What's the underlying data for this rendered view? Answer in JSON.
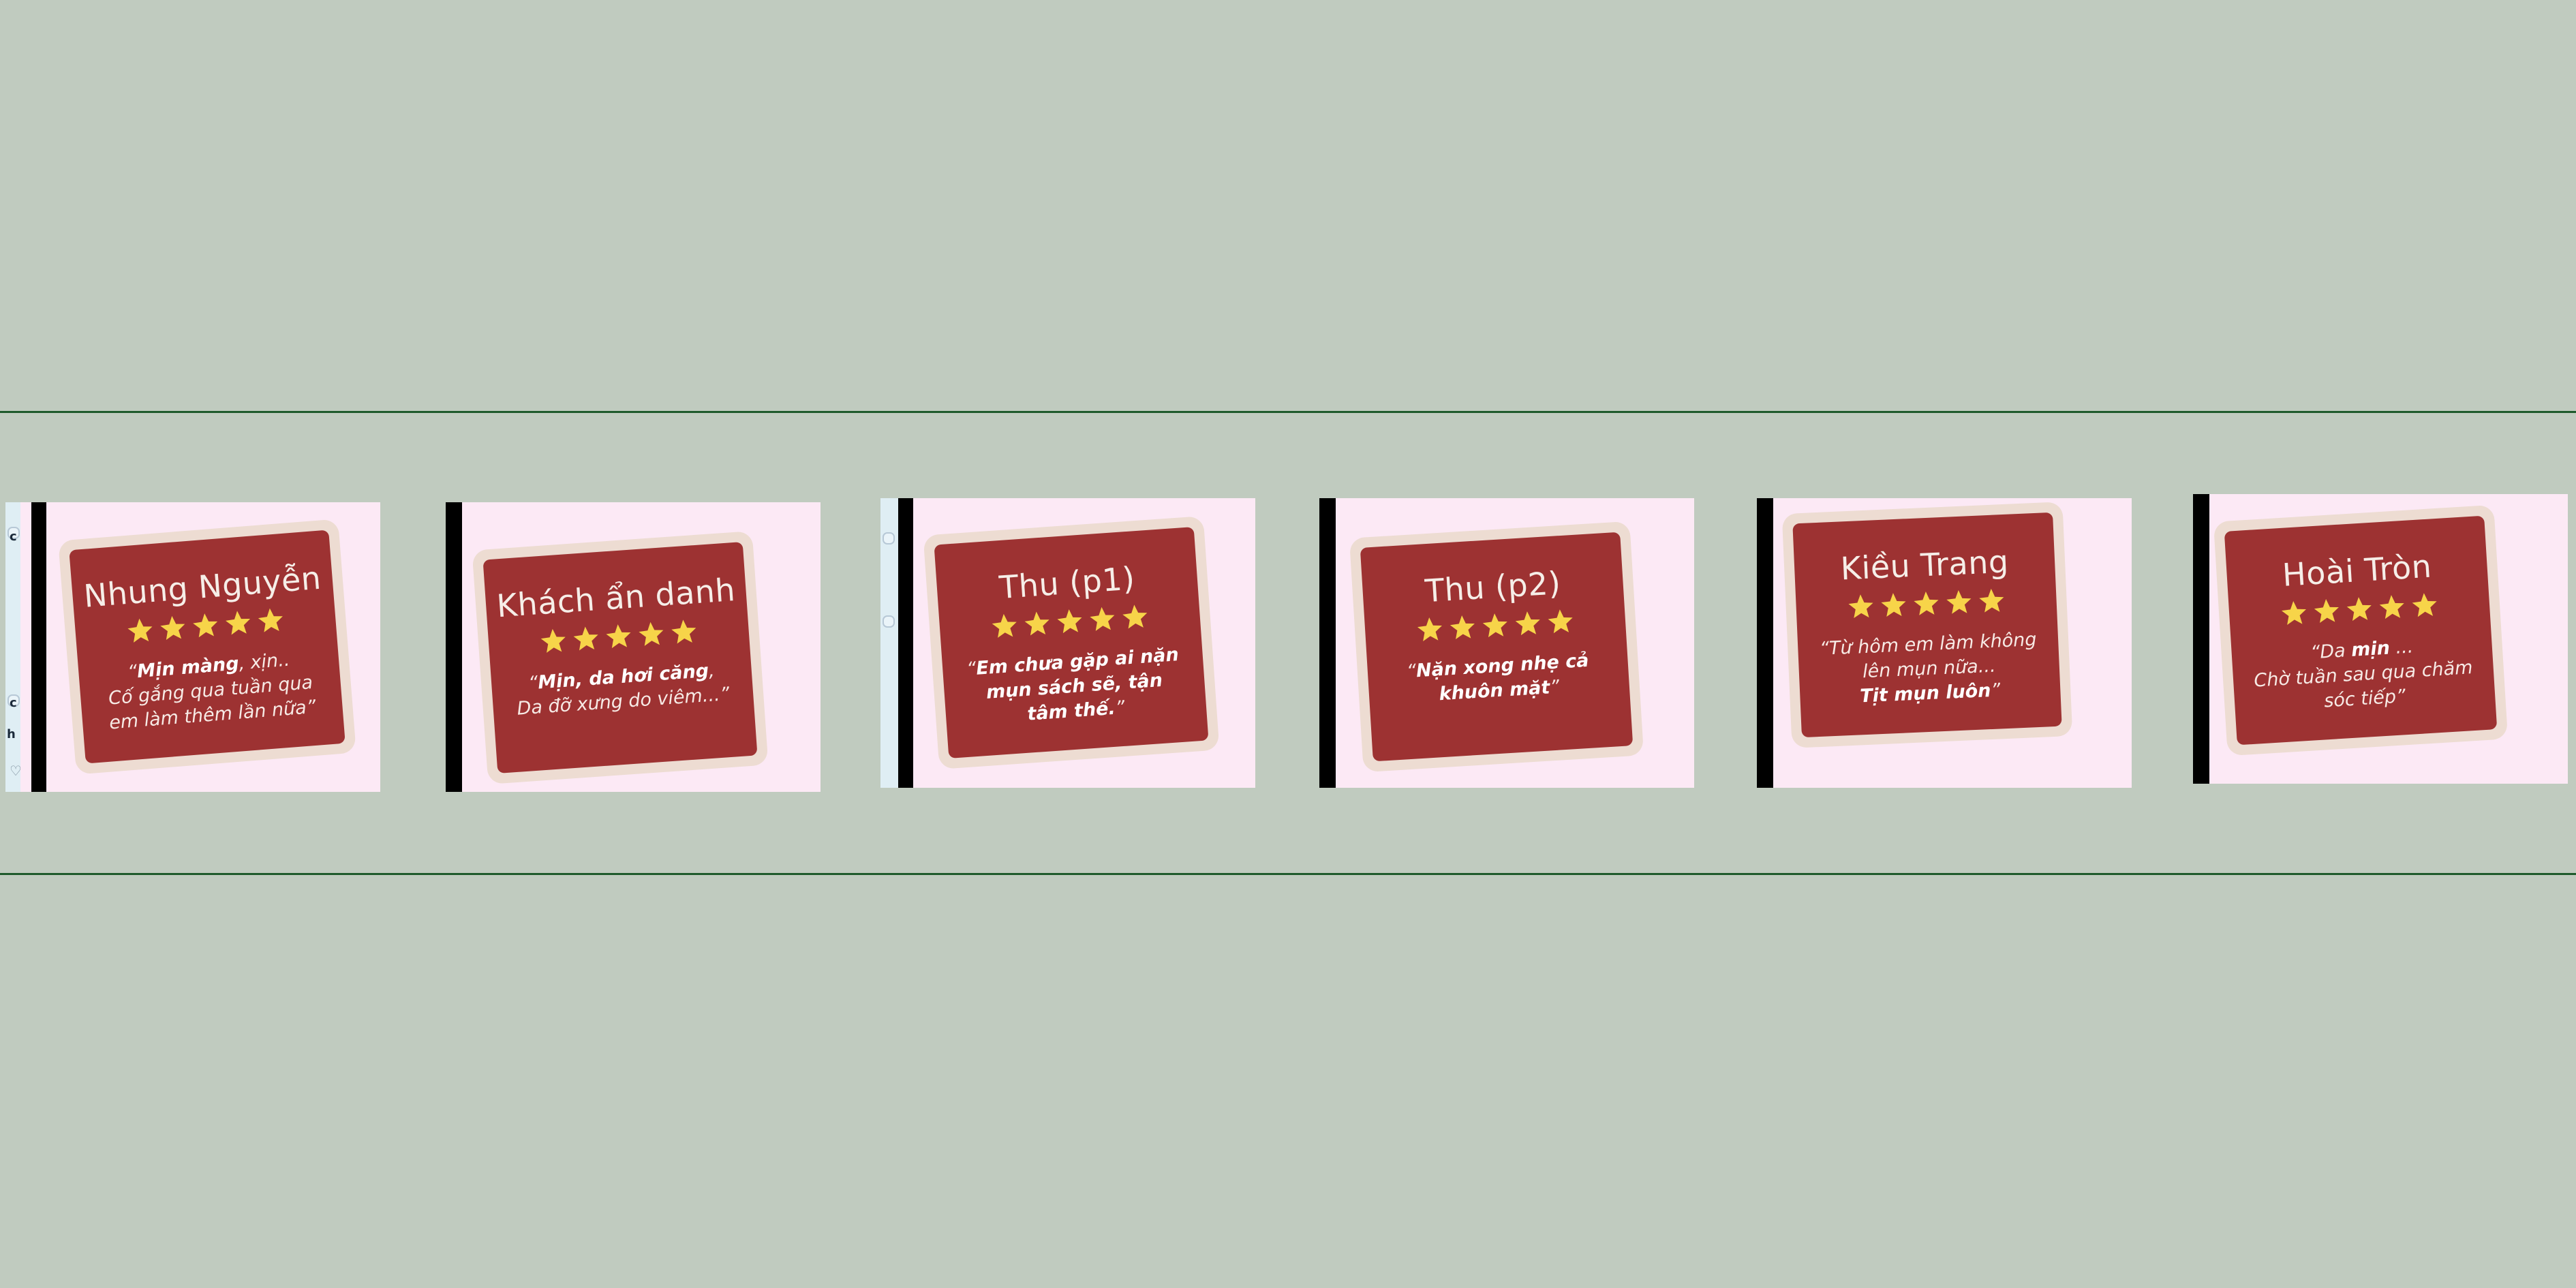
{
  "colors": {
    "background": "#c0cbbf",
    "rule_line": "#1e5a2b",
    "slide_background": "#fce9f5",
    "card": "#9d3232",
    "card_frame": "#eddcd2",
    "star": "#f7d449"
  },
  "rating_icon": "star-icon",
  "cards": [
    {
      "name": "Nhung Nguyễn",
      "stars": 5,
      "quote": [
        {
          "text": "“",
          "bold": false
        },
        {
          "text": "Mịn màng",
          "bold": true
        },
        {
          "text": ", xịn..",
          "bold": false
        },
        {
          "text": "\n",
          "bold": false
        },
        {
          "text": "Cố gắng qua tuần qua",
          "bold": false
        },
        {
          "text": "\n",
          "bold": false
        },
        {
          "text": "em làm thêm lần nữa”",
          "bold": false
        }
      ],
      "strip_texts": [
        "c",
        "c",
        "h"
      ]
    },
    {
      "name": "Khách ẩn danh",
      "stars": 5,
      "quote": [
        {
          "text": "“",
          "bold": false
        },
        {
          "text": "Mịn, da hơi căng",
          "bold": true
        },
        {
          "text": ",",
          "bold": false
        },
        {
          "text": "\n",
          "bold": false
        },
        {
          "text": "Da đỡ xưng do viêm...”",
          "bold": false
        }
      ]
    },
    {
      "name": "Thu (p1)",
      "stars": 5,
      "quote": [
        {
          "text": "“",
          "bold": false
        },
        {
          "text": "Em chưa gặp ai nặn mụn sách sẽ, tận tâm thế.",
          "bold": true
        },
        {
          "text": "”",
          "bold": false
        }
      ]
    },
    {
      "name": "Thu (p2)",
      "stars": 5,
      "quote": [
        {
          "text": "“",
          "bold": false
        },
        {
          "text": "Nặn xong nhẹ cả khuôn mặt",
          "bold": true
        },
        {
          "text": "”",
          "bold": false
        }
      ]
    },
    {
      "name": "Kiều Trang",
      "stars": 5,
      "quote": [
        {
          "text": "“Từ hôm em làm không",
          "bold": false
        },
        {
          "text": "\n",
          "bold": false
        },
        {
          "text": "lên mụn nữa...",
          "bold": false
        },
        {
          "text": "\n",
          "bold": false
        },
        {
          "text": "Tịt mụn luôn",
          "bold": true
        },
        {
          "text": "”",
          "bold": false
        }
      ]
    },
    {
      "name": "Hoài Tròn",
      "stars": 5,
      "quote": [
        {
          "text": "“Da ",
          "bold": false
        },
        {
          "text": "mịn",
          "bold": true
        },
        {
          "text": " ...",
          "bold": false
        },
        {
          "text": "\n",
          "bold": false
        },
        {
          "text": "Chờ tuần sau qua chăm",
          "bold": false
        },
        {
          "text": "\n",
          "bold": false
        },
        {
          "text": "sóc tiếp”",
          "bold": false
        }
      ]
    }
  ]
}
